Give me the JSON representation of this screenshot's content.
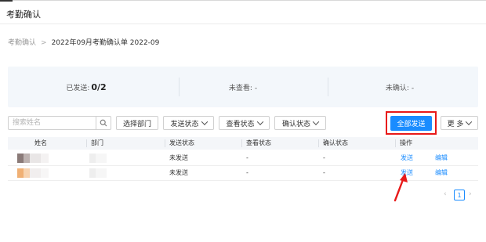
{
  "page": {
    "title": "考勤确认"
  },
  "breadcrumb": {
    "parent": "考勤确认",
    "separator": ">",
    "current": "2022年09月考勤确认单 2022-09"
  },
  "stats": {
    "sent_label": "已发送:",
    "sent_value": "0/2",
    "unviewed_label": "未查看: -",
    "unconfirmed_label": "未确认: -"
  },
  "toolbar": {
    "search_placeholder": "搜索姓名",
    "select_dept": "选择部门",
    "send_status": "发送状态",
    "view_status": "查看状态",
    "confirm_status": "确认状态",
    "send_all": "全部发送",
    "more": "更 多"
  },
  "table": {
    "headers": [
      "姓名",
      "部门",
      "发送状态",
      "查看状态",
      "确认状态",
      "操作"
    ],
    "rows": [
      {
        "name": "",
        "dept": "",
        "send_status": "未发送",
        "view_status": "-",
        "confirm_status": "-",
        "action_send": "发送",
        "action_edit": "编辑"
      },
      {
        "name": "",
        "dept": "",
        "send_status": "未发送",
        "view_status": "-",
        "confirm_status": "-",
        "action_send": "发送",
        "action_edit": "编辑"
      }
    ]
  },
  "pagination": {
    "current_page": "1"
  },
  "colors": {
    "primary": "#1a8cff",
    "highlight": "#e81919",
    "stats_bg": "#f3f7fb"
  },
  "icons": {
    "search": "search-icon",
    "chevron": "chevron-down-icon",
    "annotation": "red-arrow-icon"
  }
}
